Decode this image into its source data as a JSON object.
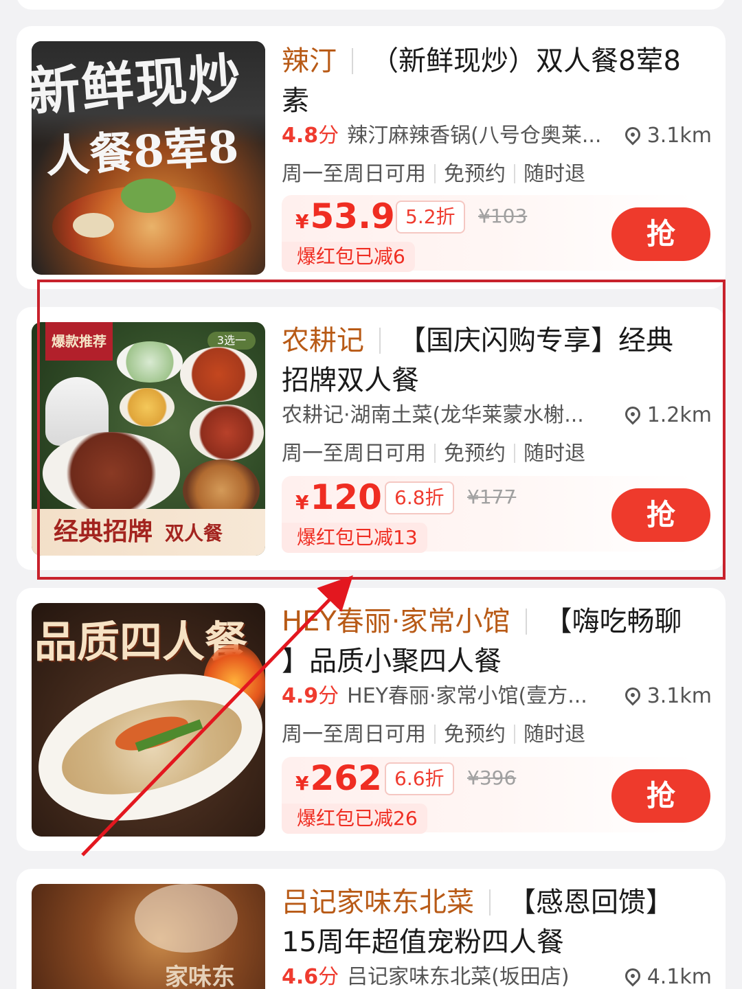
{
  "colors": {
    "accent": "#ef2d22",
    "shop": "#b85a16",
    "highlight": "#c8222c",
    "grab_button": "#ee3a2c"
  },
  "grab_label": "抢",
  "deals": [
    {
      "shop": "辣汀",
      "title_a": "（新鲜现炒）双人餐8荤8",
      "title_b": "素",
      "rating_num": "4.8",
      "rating_unit": "分",
      "store": "辣汀麻辣香锅(八号仓奥莱...",
      "distance": "3.1km",
      "tags": [
        "周一至周日可用",
        "免预约",
        "随时退"
      ],
      "currency": "¥",
      "price": "53.9",
      "discount": "5.2折",
      "original": "¥103",
      "redpack": "爆红包已减6",
      "thumb_text_1": "新鲜现炒",
      "thumb_text_2": "人餐8荤8"
    },
    {
      "shop": "农耕记",
      "title_a": "【国庆闪购专享】经典",
      "title_b": "招牌双人餐",
      "rating_num": "",
      "rating_unit": "",
      "store": "农耕记·湖南土菜(龙华莱蒙水榭...",
      "distance": "1.2km",
      "tags": [
        "周一至周日可用",
        "免预约",
        "随时退"
      ],
      "currency": "¥",
      "price": "120",
      "discount": "6.8折",
      "original": "¥177",
      "redpack": "爆红包已减13",
      "thumb_badge": "爆款推荐",
      "thumb_choice": "3选一",
      "thumb_caption_1": "经典招牌",
      "thumb_caption_2": "双人餐"
    },
    {
      "shop": "HEY春丽·家常小馆",
      "title_a": "【嗨吃畅聊",
      "title_b": "】品质小聚四人餐",
      "rating_num": "4.9",
      "rating_unit": "分",
      "store": "HEY春丽·家常小馆(壹方...",
      "distance": "3.1km",
      "tags": [
        "周一至周日可用",
        "免预约",
        "随时退"
      ],
      "currency": "¥",
      "price": "262",
      "discount": "6.6折",
      "original": "¥396",
      "redpack": "爆红包已减26",
      "thumb_text_1": "品质四人餐"
    },
    {
      "shop": "吕记家味东北菜",
      "title_a": "【感恩回馈】",
      "title_b": "15周年超值宠粉四人餐",
      "rating_num": "4.6",
      "rating_unit": "分",
      "store": "吕记家味东北菜(坂田店)",
      "distance": "4.1km",
      "thumb_text_1": "家味东"
    }
  ]
}
